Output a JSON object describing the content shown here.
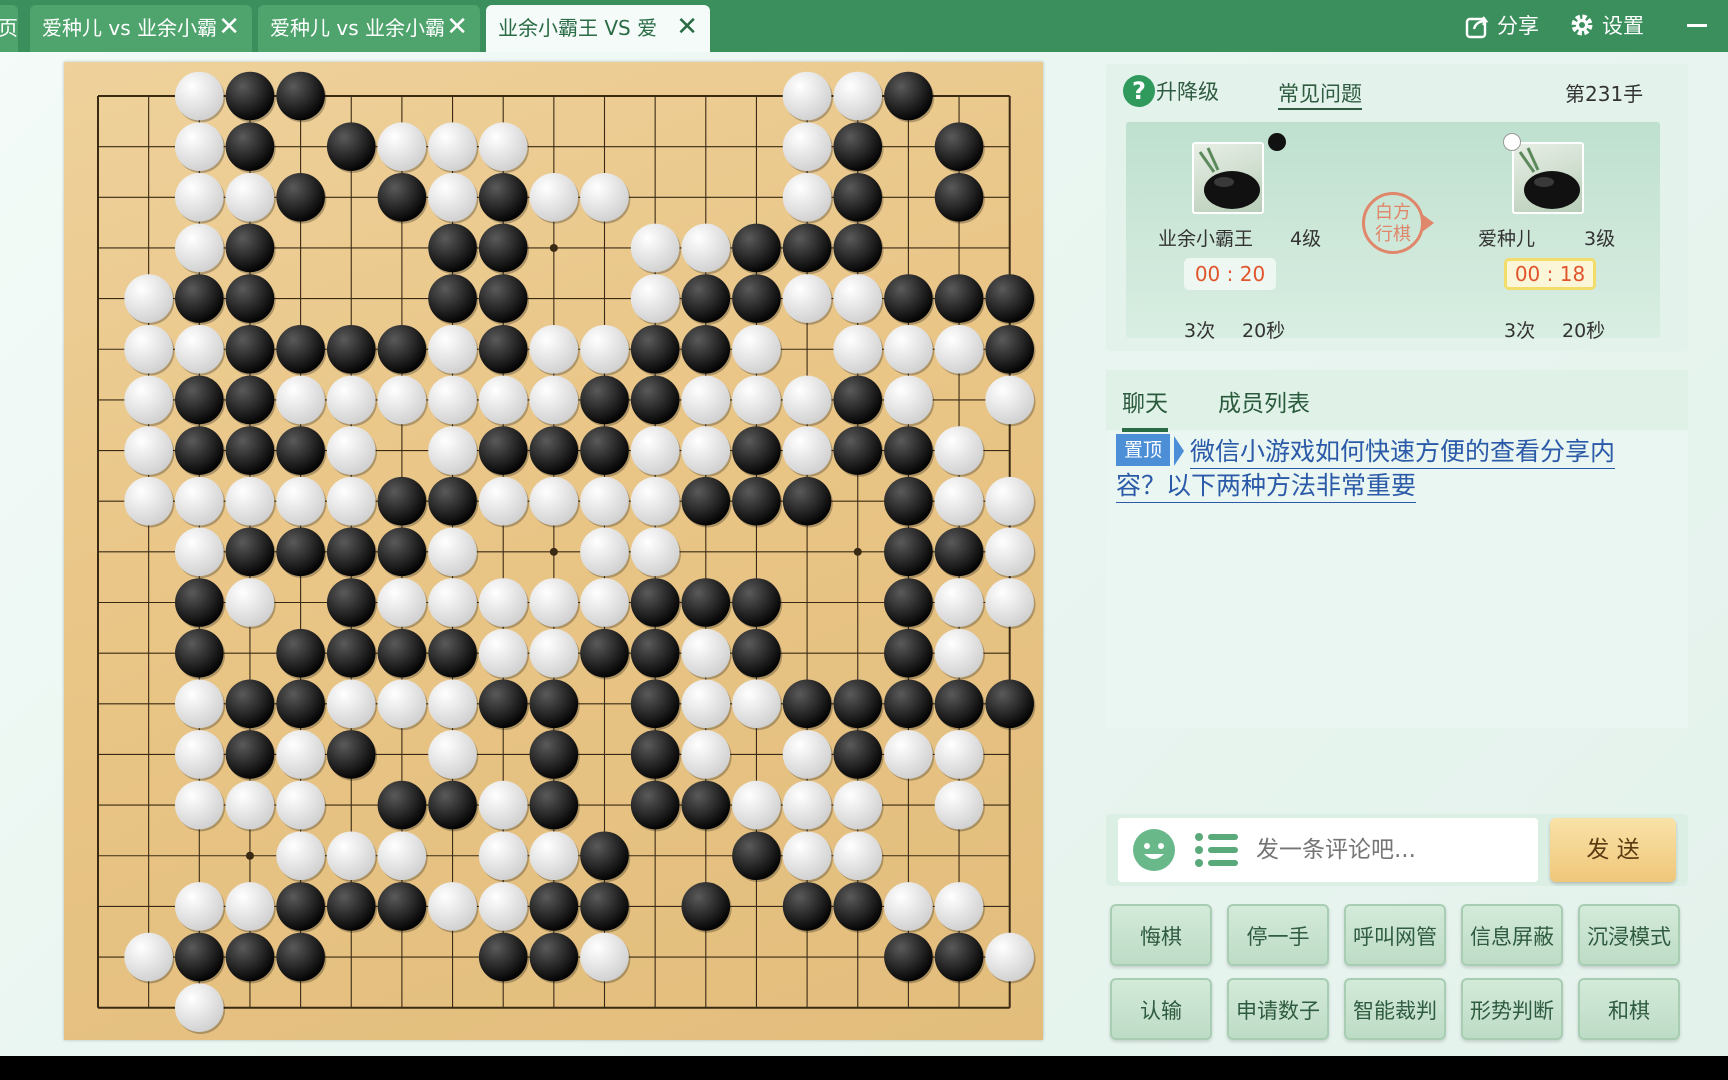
{
  "tabs": [
    {
      "label": "页",
      "active": false
    },
    {
      "label": "爱种儿 vs 业余小霸",
      "active": false
    },
    {
      "label": "爱种儿 vs 业余小霸",
      "active": false
    },
    {
      "label": "业余小霸王 VS 爱",
      "active": true
    }
  ],
  "header": {
    "share_label": "分享",
    "settings_label": "设置"
  },
  "info": {
    "help_label": "升降级",
    "faq_label": "常见问题",
    "move_number": "第231手",
    "turn_label_line1": "白方",
    "turn_label_line2": "行棋",
    "black_player": {
      "name": "业余小霸王",
      "rank": "4级",
      "time": "00 : 20",
      "byoyomi_count": "3次",
      "byoyomi_time": "20秒",
      "stone": "black"
    },
    "white_player": {
      "name": "爱种儿",
      "rank": "3级",
      "time": "00 : 18",
      "byoyomi_count": "3次",
      "byoyomi_time": "20秒",
      "stone": "white"
    }
  },
  "chat": {
    "tab_chat": "聊天",
    "tab_members": "成员列表",
    "pinned_badge": "置顶",
    "pinned_line1": "微信小游戏如何快速方便的查看分享内",
    "pinned_line2": "容？以下两种方法非常重要"
  },
  "input": {
    "placeholder": "发一条评论吧...",
    "send_label": "发 送"
  },
  "buttons": {
    "row1": [
      "悔棋",
      "停一手",
      "呼叫网管",
      "信息屏蔽",
      "沉浸模式"
    ],
    "row2": [
      "认输",
      "申请数子",
      "智能裁判",
      "形势判断",
      "和棋"
    ]
  },
  "colors": {
    "header_green": "#3b8f5d",
    "timer_red": "#e0552c",
    "board_wood": "#e9c586"
  },
  "board": {
    "size": 19,
    "rows": [
      "..WBB.........WWB..",
      "..WB.BWWW.....WB.B.",
      "..WWB.BWBWW...WB.B.",
      "..WB...BB..WWBBB...",
      ".WBB...BB..WBBWWBBB",
      ".WWBBBBWBWWBBW.WWWB",
      ".WBBWWWWWWBBWWWBW.W",
      ".WBBBW.WBBBWWBWBBW.",
      ".WWWWWBBWWWWBBB.BWW",
      "..WBBBBW..WW....BBW",
      "..BW.BWWWWWBBB..BWW",
      "..B.BBBBWWBBWB..BW.",
      "..WBBWWWBB.BWWBBBBB",
      "..WBWB.W.B.BW.WBWW.",
      "..WWW.BBWB.BBWWW.W.",
      "....WWW.WWB..BWW...",
      "..WWBBBWWBB.B.BBWW.",
      ".WBBB...BBW.....BBW",
      "..W................"
    ]
  }
}
